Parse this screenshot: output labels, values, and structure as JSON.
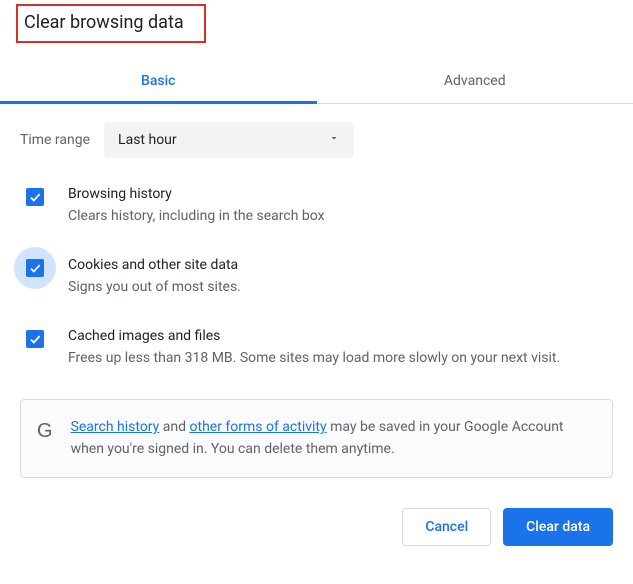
{
  "dialog": {
    "title": "Clear browsing data",
    "tabs": {
      "basic": "Basic",
      "advanced": "Advanced"
    },
    "time_range": {
      "label": "Time range",
      "selected": "Last hour"
    },
    "options": [
      {
        "title": "Browsing history",
        "desc": "Clears history, including in the search box"
      },
      {
        "title": "Cookies and other site data",
        "desc": "Signs you out of most sites."
      },
      {
        "title": "Cached images and files",
        "desc": "Frees up less than 318 MB. Some sites may load more slowly on your next visit."
      }
    ],
    "account_notice": {
      "link_search_history": "Search history",
      "mid1": " and ",
      "link_other_forms": "other forms of activity",
      "tail": " may be saved in your Google Account when you're signed in. You can delete them anytime."
    },
    "actions": {
      "cancel": "Cancel",
      "clear": "Clear data"
    }
  }
}
